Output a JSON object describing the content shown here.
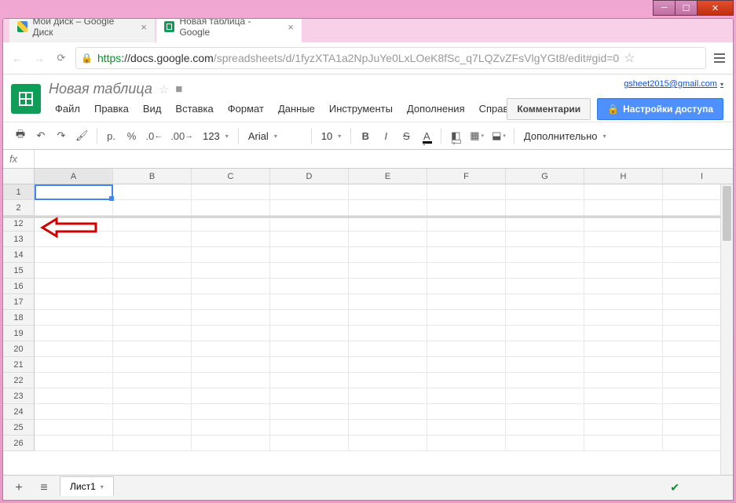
{
  "window": {
    "tabs": [
      {
        "title": "Мой диск – Google Диск",
        "icon": "drive"
      },
      {
        "title": "Новая таблица - Google",
        "icon": "sheets",
        "active": true
      }
    ],
    "url_https": "https",
    "url_domain": "://docs.google.com",
    "url_path": "/spreadsheets/d/1fyzXTA1a2NpJuYe0LxLOeK8fSc_q7LQZvZFsVlgYGt8/edit#gid=0"
  },
  "user": {
    "email": "gsheet2015@gmail.com"
  },
  "doc": {
    "title": "Новая таблица"
  },
  "menus": [
    "Файл",
    "Правка",
    "Вид",
    "Вставка",
    "Формат",
    "Данные",
    "Инструменты",
    "Дополнения",
    "Справка"
  ],
  "header_buttons": {
    "comments": "Комментарии",
    "share": "Настройки доступа"
  },
  "toolbar": {
    "currency": "р.",
    "percent": "%",
    "dec_dec": ".0←",
    "inc_dec": ".00→",
    "format_123": "123",
    "font": "Arial",
    "size": "10",
    "more": "Дополнительно"
  },
  "formula_bar": {
    "label": "fx",
    "value": ""
  },
  "columns": [
    "A",
    "B",
    "C",
    "D",
    "E",
    "F",
    "G",
    "H",
    "I"
  ],
  "rows": [
    "1",
    "2",
    "12",
    "13",
    "14",
    "15",
    "16",
    "17",
    "18",
    "19",
    "20",
    "21",
    "22",
    "23",
    "24",
    "25",
    "26"
  ],
  "selected_cell": {
    "row": 0,
    "col": 0
  },
  "sheet_tabs": {
    "active": "Лист1"
  }
}
